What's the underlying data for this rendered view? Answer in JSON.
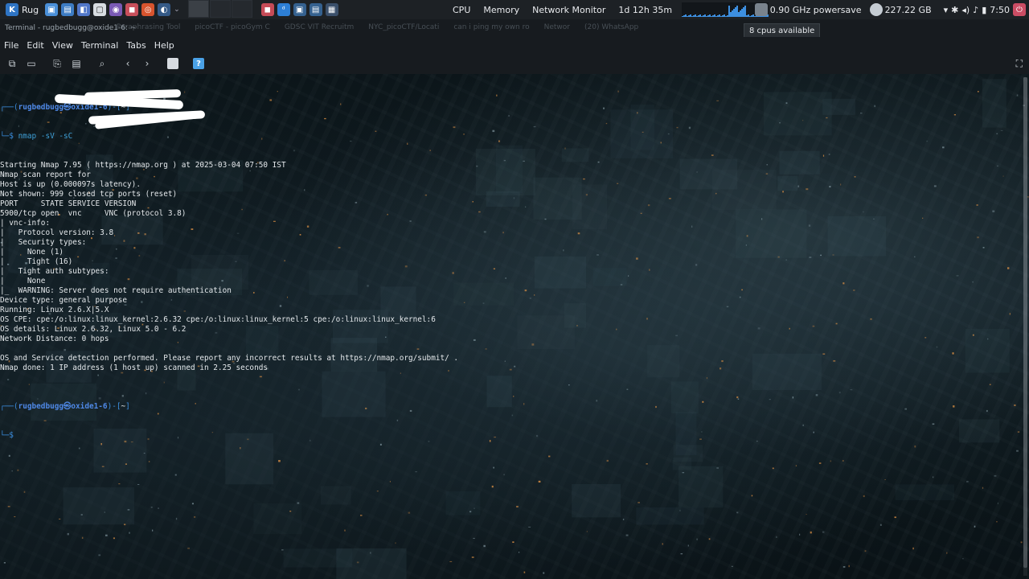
{
  "taskbar": {
    "app_label": "Rug",
    "monitors": [
      "CPU",
      "Memory",
      "Network Monitor"
    ],
    "uptime": "1d 12h 35m",
    "cpu_freq": "0.90 GHz powersave",
    "disk": "227.22 GB",
    "clock": "7:50",
    "tooltip": "8 cpus available"
  },
  "window": {
    "title": "Terminal - rugbedbugg@oxide1-6: ~",
    "ghost_tabs": [
      "Paraphrasing Tool",
      "picoCTF - picoGym C",
      "GDSC VIT Recruitm",
      "NYC_picoCTF/Locati",
      "can i ping my own ro",
      "Networ",
      "(20) WhatsApp"
    ]
  },
  "menubar": {
    "items": [
      "File",
      "Edit",
      "View",
      "Terminal",
      "Tabs",
      "Help"
    ]
  },
  "toolbar": {
    "icons": [
      "new-tab-icon",
      "new-window-icon",
      "copy-icon",
      "paste-icon",
      "search-icon",
      "back-icon",
      "forward-icon",
      "settings-icon",
      "help-icon"
    ]
  },
  "terminal": {
    "prompt1": {
      "open": "┌──(",
      "user": "rugbedbugg㉿oxide1-6",
      "close": ")-[",
      "path": "~",
      "end": "]",
      "dollar": "└─$ ",
      "command": "nmap -sV -sC"
    },
    "output": [
      "Starting Nmap 7.95 ( https://nmap.org ) at 2025-03-04 07:50 IST",
      "Nmap scan report for",
      "Host is up (0.000097s latency).",
      "Not shown: 999 closed tcp ports (reset)",
      "PORT     STATE SERVICE VERSION",
      "5900/tcp open  vnc     VNC (protocol 3.8)",
      "| vnc-info:",
      "|   Protocol version: 3.8",
      "|   Security types:",
      "|     None (1)",
      "|     Tight (16)",
      "|   Tight auth subtypes:",
      "|     None",
      "|_  WARNING: Server does not require authentication",
      "Device type: general purpose",
      "Running: Linux 2.6.X|5.X",
      "OS CPE: cpe:/o:linux:linux_kernel:2.6.32 cpe:/o:linux:linux_kernel:5 cpe:/o:linux:linux_kernel:6",
      "OS details: Linux 2.6.32, Linux 5.0 - 6.2",
      "Network Distance: 0 hops",
      "",
      "OS and Service detection performed. Please report any incorrect results at https://nmap.org/submit/ .",
      "Nmap done: 1 IP address (1 host up) scanned in 2.25 seconds",
      ""
    ],
    "prompt2": {
      "open": "┌──(",
      "user": "rugbedbugg㉿oxide1-6",
      "close": ")-[",
      "path": "~",
      "end": "]",
      "dollar": "└─$ "
    }
  },
  "colors": {
    "prompt_blue": "#3b8ee0",
    "text": "#e4e8eb",
    "panel": "#1d2125"
  }
}
